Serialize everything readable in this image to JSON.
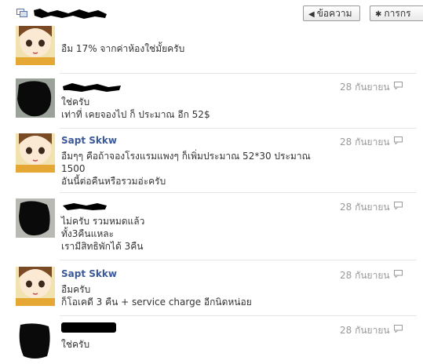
{
  "header": {
    "messages_button": "ข้อความ",
    "actions_button": "การกร"
  },
  "messages": [
    {
      "author": "",
      "time": "",
      "lines": [
        "อืม 17% จากค่าห้องใช่มั้ยครับ"
      ]
    },
    {
      "author": "",
      "time": "28 กันยายน",
      "lines": [
        "ใช่ครับ",
        "เท่าที่ เคยจองไป ก็ ประมาณ อีก 52$"
      ]
    },
    {
      "author": "Sapt Skkw",
      "time": "28 กันยายน",
      "lines": [
        "อืมๆๆ คือถ้าจองโรงแรมแพงๆ ก็เพิ่มประมาณ 52*30 ประมาณ",
        "1500",
        "อันนี้ต่อคืนหรือรวมอ่ะครับ"
      ]
    },
    {
      "author": "",
      "time": "28 กันยายน",
      "lines": [
        "ไม่ครับ รวมหมดแล้ว",
        "ทั้ง3คืนแหละ",
        "เรามีสิทธิพักได้ 3คืน"
      ]
    },
    {
      "author": "Sapt Skkw",
      "time": "28 กันยายน",
      "lines": [
        "อืมครับ",
        "ก็โอเคดี 3 คืน + service charge อีกนิดหน่อย"
      ]
    },
    {
      "author": "",
      "time": "28 กันยายน",
      "lines": [
        "ใช่ครับ"
      ]
    }
  ]
}
